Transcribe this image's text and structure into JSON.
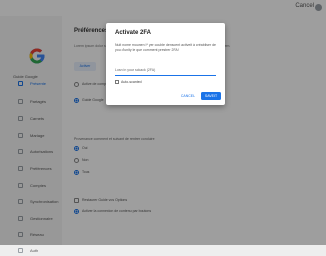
{
  "topbar": {
    "cancel_label": "Cancel"
  },
  "sidebar": {
    "title": "Guide Google",
    "items": [
      {
        "label": "Présente",
        "active": true
      },
      {
        "label": "Partagés"
      },
      {
        "label": "Carnets"
      },
      {
        "label": "Mariage"
      },
      {
        "label": "Autorisations"
      },
      {
        "label": "Préférences"
      },
      {
        "label": "Comptes"
      },
      {
        "label": "Synchronisation"
      },
      {
        "label": "Gestionnaire"
      },
      {
        "label": "Réseau"
      },
      {
        "label": "Auth"
      }
    ]
  },
  "panel": {
    "title": "Préférences",
    "desc": "Lorem ipsum dolor sit amet, consectetur adipiscing elit. Nam eu nunc mauris, et in Nulla quam lorem.",
    "button_label": "Activer",
    "options": [
      {
        "label": "Active de compte"
      },
      {
        "label": "Guide Google"
      }
    ],
    "section_label": "Provenance comment et suivant de rentrer conduire",
    "radios": [
      {
        "label": "Oui"
      },
      {
        "label": "Non"
      },
      {
        "label": "Tous"
      }
    ],
    "checks": [
      {
        "label": "Restaurer Guide vos Options"
      },
      {
        "label": "Activer la connexion de contenu par boutons"
      }
    ]
  },
  "dialog": {
    "title": "Activate 2FA",
    "message": "Nuit nome mounen I* yer couble denscent activeit à créabliser de you d'unity le que comment prestrer 2FA!",
    "input_placeholder": "Losn in your sckack (2FA)",
    "checkbox_label": "Auto-scanted",
    "cancel_label": "CANCEL",
    "confirm_label": "SAVEIT"
  }
}
